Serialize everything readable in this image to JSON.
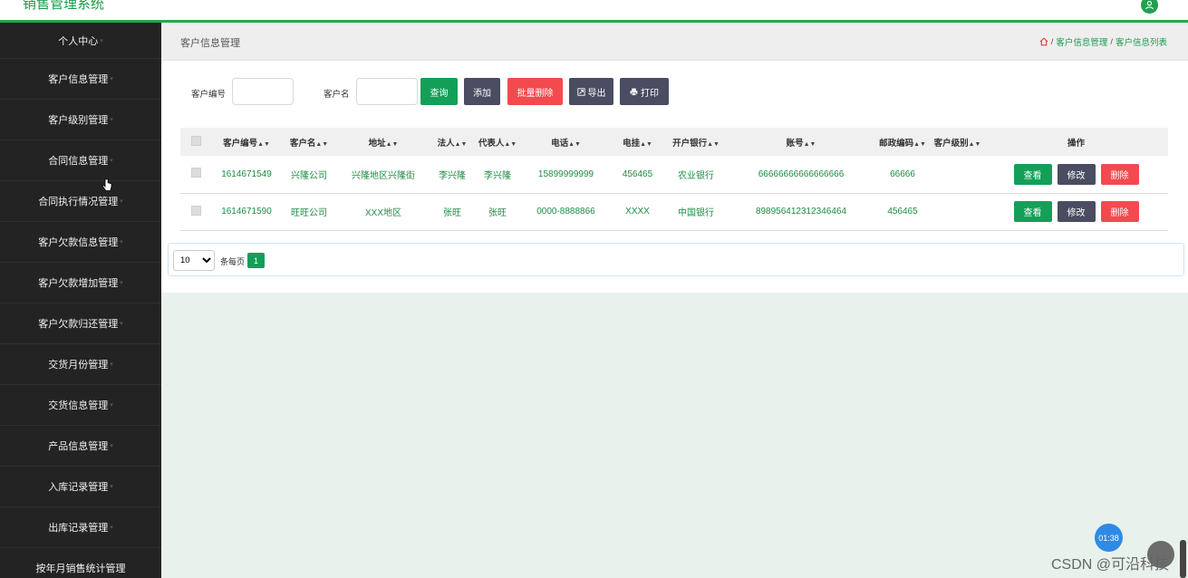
{
  "app": {
    "title": "销售管理系统"
  },
  "sidebar": {
    "items": [
      {
        "label": "个人中心"
      },
      {
        "label": "客户信息管理"
      },
      {
        "label": "客户级别管理"
      },
      {
        "label": "合同信息管理"
      },
      {
        "label": "合同执行情况管理"
      },
      {
        "label": "客户欠款信息管理"
      },
      {
        "label": "客户欠款增加管理"
      },
      {
        "label": "客户欠款归还管理"
      },
      {
        "label": "交货月份管理"
      },
      {
        "label": "交货信息管理"
      },
      {
        "label": "产品信息管理"
      },
      {
        "label": "入库记录管理"
      },
      {
        "label": "出库记录管理"
      },
      {
        "label": "按年月销售统计管理"
      }
    ]
  },
  "header": {
    "page_title": "客户信息管理",
    "breadcrumb": [
      "客户信息管理",
      "客户信息列表"
    ],
    "separator": "/"
  },
  "search": {
    "customer_no_label": "客户编号",
    "customer_no_value": "",
    "customer_name_label": "客户名",
    "customer_name_value": ""
  },
  "toolbar": {
    "query_label": "查询",
    "add_label": "添加",
    "batch_delete_label": "批量删除",
    "export_label": "导出",
    "print_label": "打印"
  },
  "table": {
    "columns": [
      "客户编号",
      "客户名",
      "地址",
      "法人",
      "代表人",
      "电话",
      "电挂",
      "开户银行",
      "账号",
      "邮政编码",
      "客户级别",
      "操作"
    ],
    "rows": [
      {
        "customer_no": "1614671549",
        "name": "兴隆公司",
        "address": "兴隆地区兴隆街",
        "legal_person": "李兴隆",
        "representative": "李兴隆",
        "phone": "15899999999",
        "telegram": "456465",
        "bank": "农业银行",
        "account": "66666666666666666",
        "postcode": "66666",
        "level": ""
      },
      {
        "customer_no": "1614671590",
        "name": "旺旺公司",
        "address": "XXX地区",
        "legal_person": "张旺",
        "representative": "张旺",
        "phone": "0000-8888866",
        "telegram": "XXXX",
        "bank": "中国银行",
        "account": "898956412312346464",
        "postcode": "456465",
        "level": ""
      }
    ],
    "row_actions": {
      "view": "查看",
      "edit": "修改",
      "delete": "删除"
    }
  },
  "pagination": {
    "page_size": "10",
    "per_page_label": "条每页",
    "current_page": "1"
  },
  "overlay": {
    "timer": "01:38",
    "watermark": "CSDN @可沿科技"
  },
  "colors": {
    "accent": "#149f58",
    "sidebar_bg": "#232323",
    "danger": "#f34a4f",
    "slate": "#4a4c62"
  }
}
